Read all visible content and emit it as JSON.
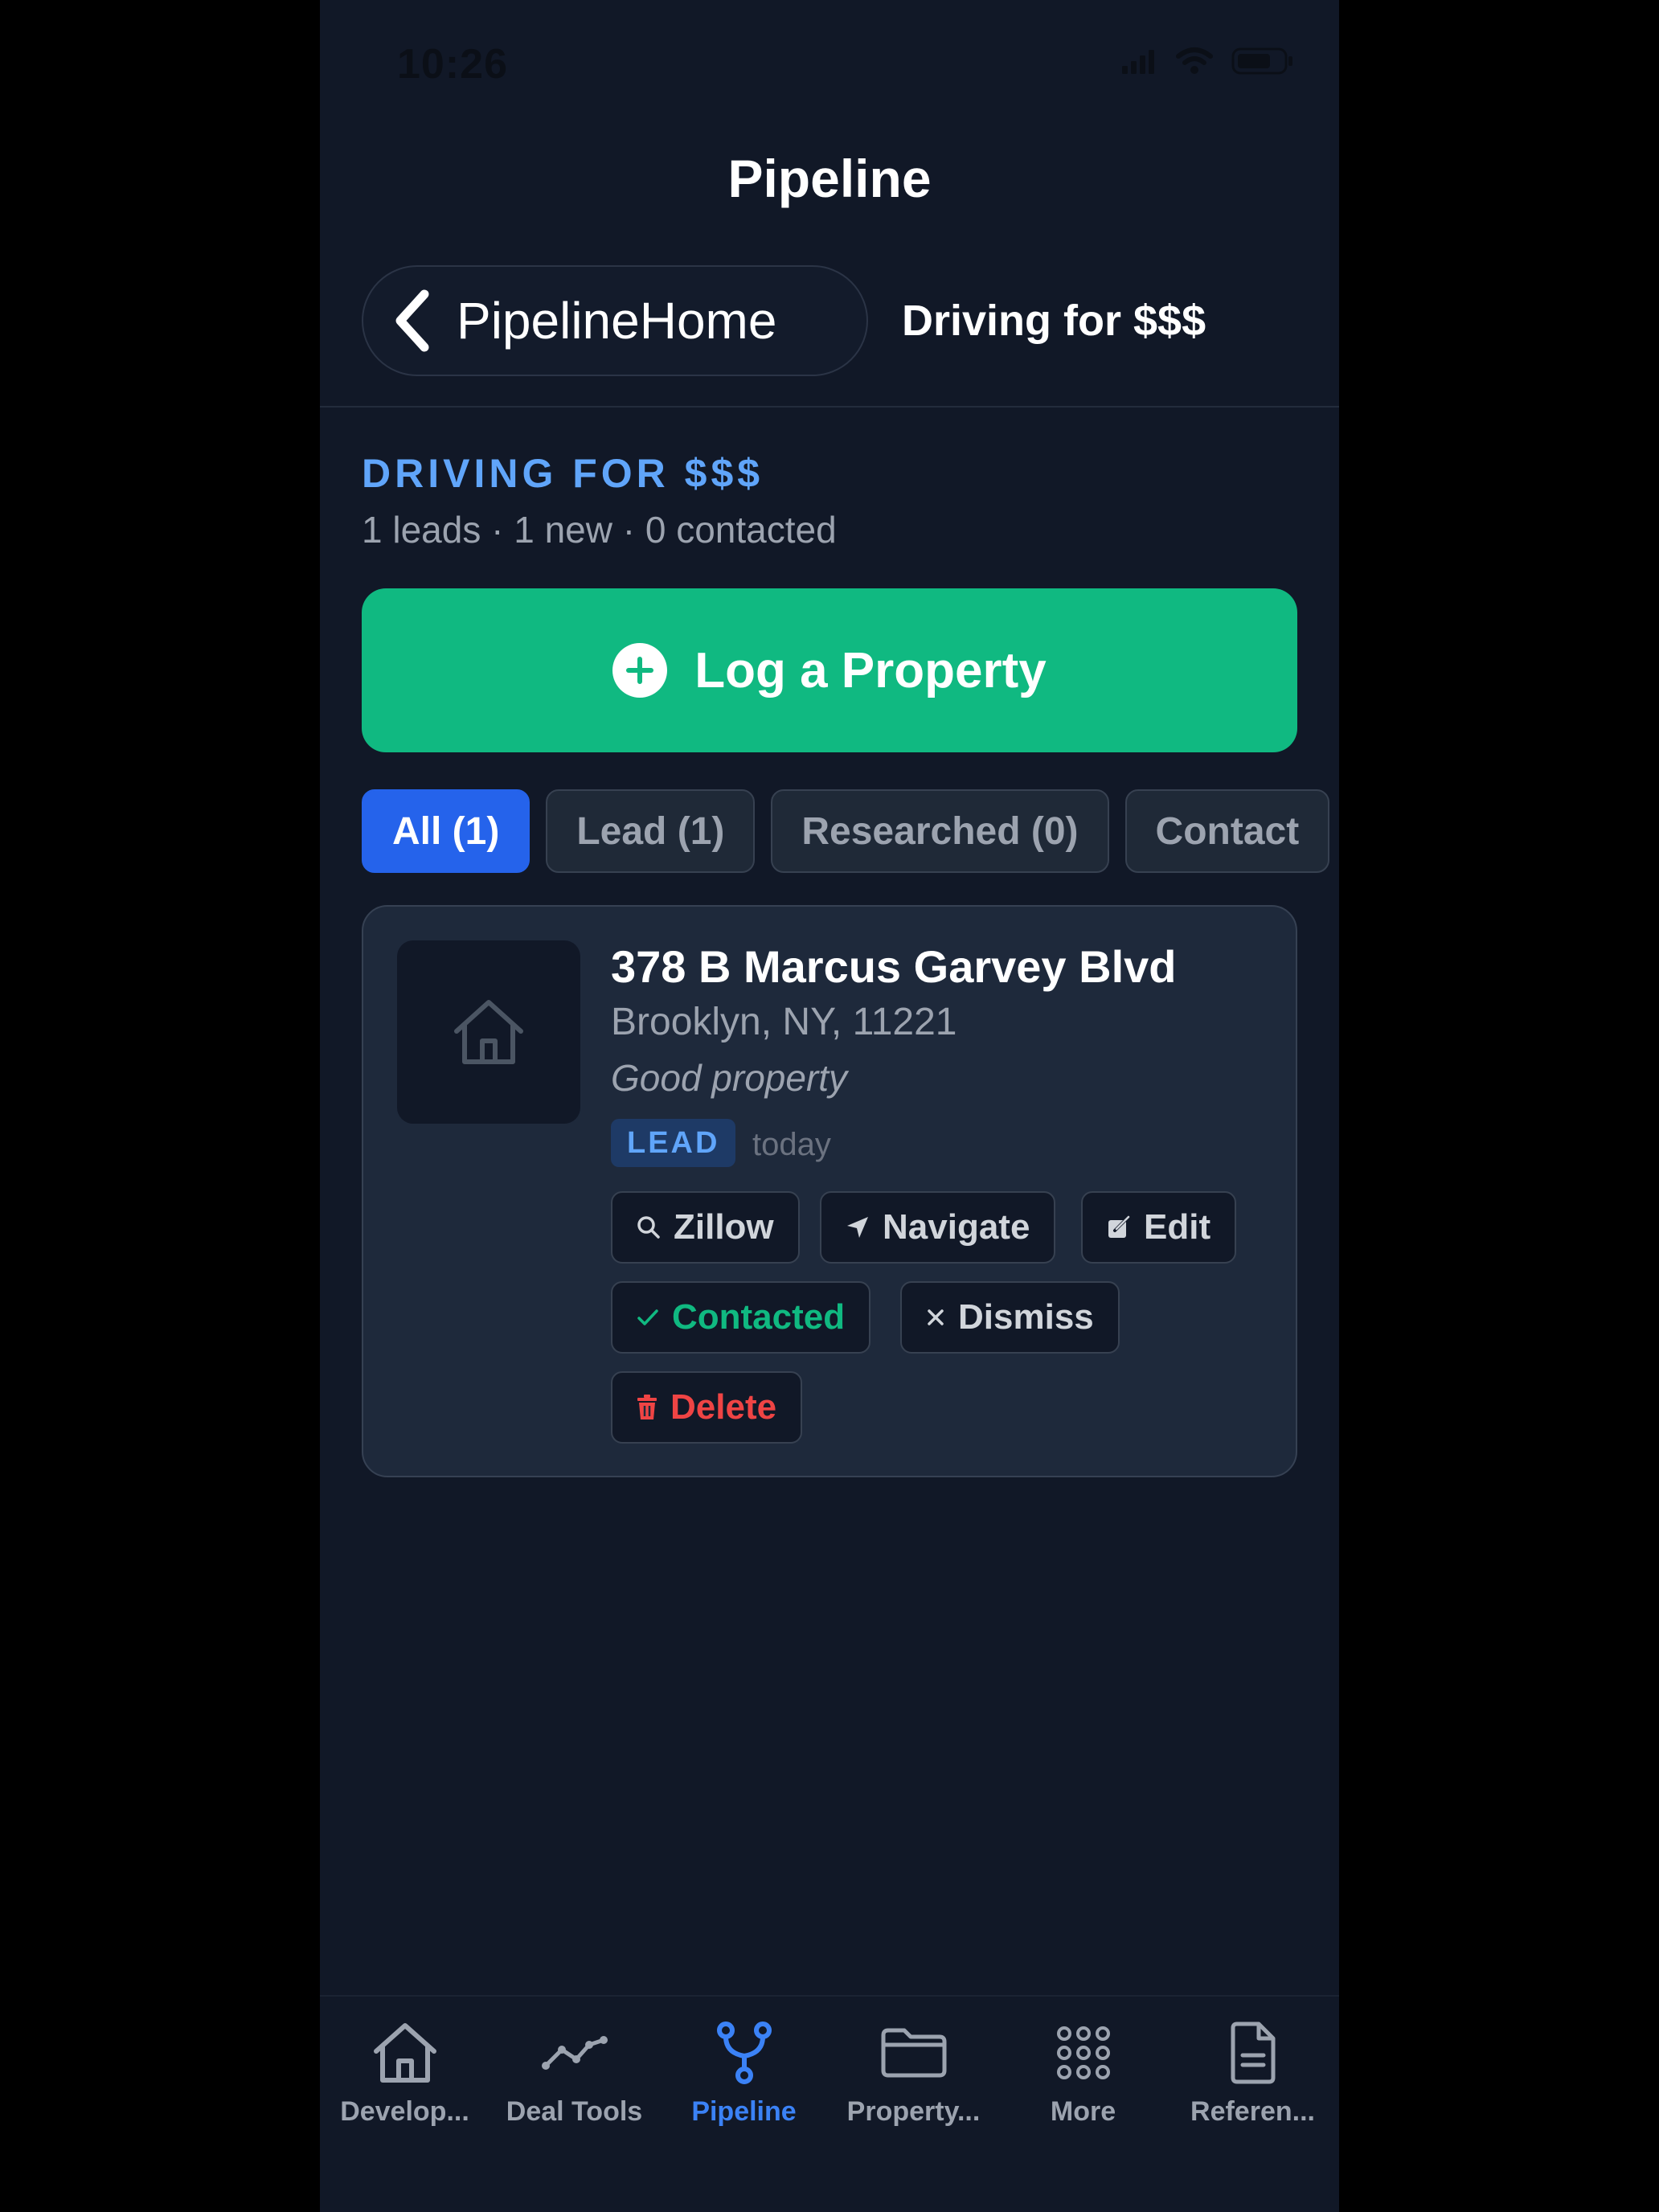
{
  "status_bar": {
    "time": "10:26"
  },
  "nav": {
    "title": "Pipeline",
    "back_label": "PipelineHome",
    "current": "Driving for $$$"
  },
  "section": {
    "title": "DRIVING FOR $$$",
    "subtitle": "1 leads · 1 new · 0 contacted"
  },
  "log_button": {
    "label": "Log a Property"
  },
  "filters": [
    {
      "label": "All (1)"
    },
    {
      "label": "Lead (1)"
    },
    {
      "label": "Researched (0)"
    },
    {
      "label": "Contact"
    }
  ],
  "property": {
    "address": "378 B Marcus Garvey Blvd",
    "city": "Brooklyn, NY, 11221",
    "note": "Good property",
    "status": "LEAD",
    "time": "today",
    "actions": {
      "zillow": "Zillow",
      "navigate": "Navigate",
      "edit": "Edit",
      "contacted": "Contacted",
      "dismiss": "Dismiss",
      "delete": "Delete"
    }
  },
  "tabs": [
    {
      "label": "Develop...",
      "icon": "home-icon"
    },
    {
      "label": "Deal Tools",
      "icon": "trend-line-icon"
    },
    {
      "label": "Pipeline",
      "icon": "pipeline-fork-icon"
    },
    {
      "label": "Property...",
      "icon": "folder-icon"
    },
    {
      "label": "More",
      "icon": "grid-dots-icon"
    },
    {
      "label": "Referen...",
      "icon": "document-icon"
    }
  ],
  "colors": {
    "background": "#111827",
    "accent_green": "#10b981",
    "accent_blue": "#2563eb",
    "section_blue": "#60a5fa",
    "contacted_green": "#10b981",
    "delete_red": "#ef4444"
  }
}
